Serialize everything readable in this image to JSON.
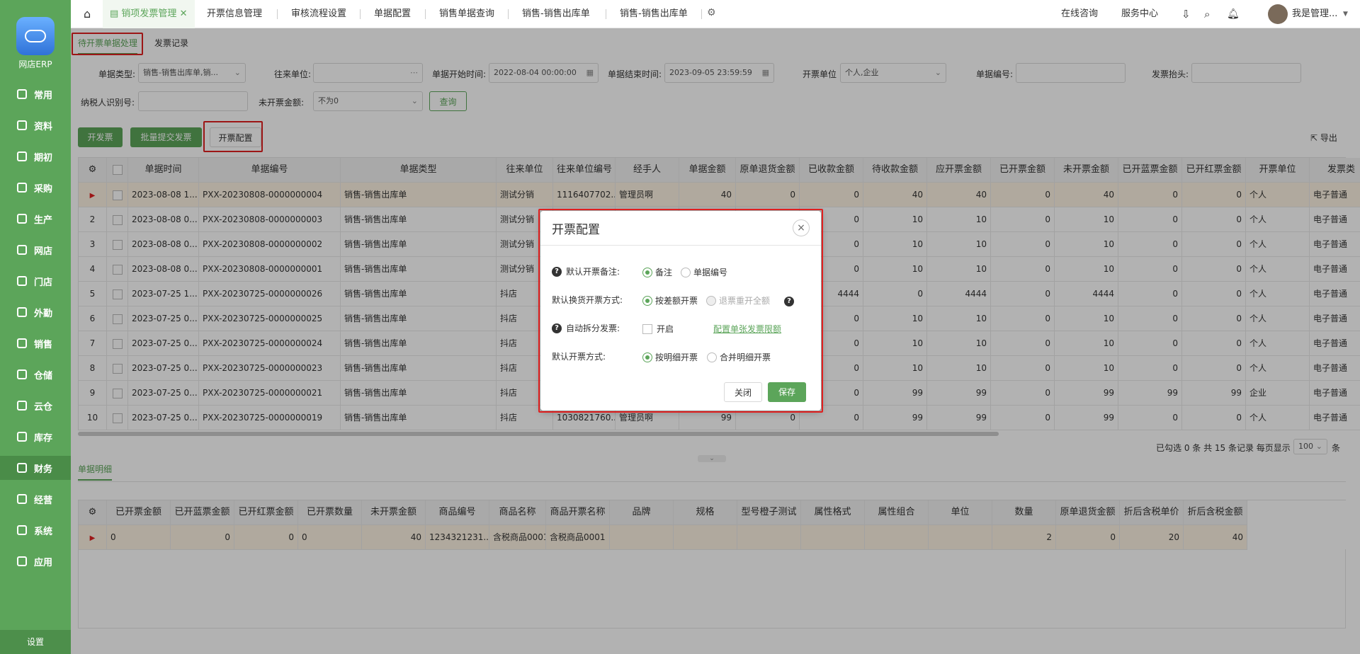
{
  "sidebar": {
    "logo_text": "网店ERP",
    "items": [
      {
        "label": "常用",
        "icon": "star-icon"
      },
      {
        "label": "资料",
        "icon": "document-icon"
      },
      {
        "label": "期初",
        "icon": "clock-icon"
      },
      {
        "label": "采购",
        "icon": "cart-icon"
      },
      {
        "label": "生产",
        "icon": "factory-icon"
      },
      {
        "label": "网店",
        "icon": "shop-icon"
      },
      {
        "label": "门店",
        "icon": "store-icon"
      },
      {
        "label": "外勤",
        "icon": "location-icon"
      },
      {
        "label": "销售",
        "icon": "chart-icon"
      },
      {
        "label": "仓储",
        "icon": "warehouse-icon"
      },
      {
        "label": "云仓",
        "icon": "cloud-icon"
      },
      {
        "label": "库存",
        "icon": "inventory-icon"
      },
      {
        "label": "财务",
        "icon": "finance-icon"
      },
      {
        "label": "经营",
        "icon": "business-icon"
      },
      {
        "label": "系统",
        "icon": "gear-icon"
      },
      {
        "label": "应用",
        "icon": "plus-icon"
      }
    ],
    "settings_label": "设置"
  },
  "topbar": {
    "tabs": [
      "销项发票管理",
      "开票信息管理",
      "审核流程设置",
      "单据配置",
      "销售单据查询",
      "销售-销售出库单",
      "销售-销售出库单"
    ],
    "online_consult": "在线咨询",
    "service_center": "服务中心",
    "user_name": "我是管理..."
  },
  "subtabs": [
    "待开票单据处理",
    "发票记录"
  ],
  "filters": {
    "doc_type_label": "单据类型:",
    "doc_type_value": "销售-销售出库单,销...",
    "partner_label": "往来单位:",
    "start_label": "单据开始时间:",
    "start_value": "2022-08-04 00:00:00",
    "end_label": "单据结束时间:",
    "end_value": "2023-09-05 23:59:59",
    "unit_label": "开票单位",
    "unit_value": "个人,企业",
    "doc_no_label": "单据编号:",
    "header_label": "发票抬头:",
    "tax_id_label": "纳税人识别号:",
    "amount_label": "未开票金额:",
    "amount_value": "不为0",
    "query_button": "查询"
  },
  "toolbar": {
    "issue_button": "开发票",
    "batch_button": "批量提交发票",
    "config_button": "开票配置",
    "export_button": "导出"
  },
  "table": {
    "headers": [
      "单据时间",
      "单据编号",
      "单据类型",
      "往来单位",
      "往来单位编号",
      "经手人",
      "单据金额",
      "原单退货金额",
      "已收款金额",
      "待收款金额",
      "应开票金额",
      "已开票金额",
      "未开票金额",
      "已开蓝票金额",
      "已开红票金额",
      "开票单位",
      "发票类"
    ],
    "rows": [
      [
        "1",
        "2023-08-08 1...",
        "PXX-20230808-0000000004",
        "销售-销售出库单",
        "测试分销",
        "1116407702...",
        "管理员啊",
        "40",
        "0",
        "0",
        "40",
        "40",
        "0",
        "40",
        "0",
        "0",
        "个人",
        "电子普通"
      ],
      [
        "2",
        "2023-08-08 0...",
        "PXX-20230808-0000000003",
        "销售-销售出库单",
        "测试分销",
        "",
        "",
        "",
        "",
        "0",
        "10",
        "10",
        "0",
        "10",
        "0",
        "0",
        "个人",
        "电子普通"
      ],
      [
        "3",
        "2023-08-08 0...",
        "PXX-20230808-0000000002",
        "销售-销售出库单",
        "测试分销",
        "",
        "",
        "",
        "",
        "0",
        "10",
        "10",
        "0",
        "10",
        "0",
        "0",
        "个人",
        "电子普通"
      ],
      [
        "4",
        "2023-08-08 0...",
        "PXX-20230808-0000000001",
        "销售-销售出库单",
        "测试分销",
        "",
        "",
        "",
        "",
        "0",
        "10",
        "10",
        "0",
        "10",
        "0",
        "0",
        "个人",
        "电子普通"
      ],
      [
        "5",
        "2023-07-25 1...",
        "PXX-20230725-0000000026",
        "销售-销售出库单",
        "抖店",
        "",
        "",
        "",
        "",
        "4444",
        "0",
        "4444",
        "0",
        "4444",
        "0",
        "0",
        "个人",
        "电子普通"
      ],
      [
        "6",
        "2023-07-25 0...",
        "PXX-20230725-0000000025",
        "销售-销售出库单",
        "抖店",
        "",
        "",
        "",
        "",
        "0",
        "10",
        "10",
        "0",
        "10",
        "0",
        "0",
        "个人",
        "电子普通"
      ],
      [
        "7",
        "2023-07-25 0...",
        "PXX-20230725-0000000024",
        "销售-销售出库单",
        "抖店",
        "",
        "",
        "",
        "",
        "0",
        "10",
        "10",
        "0",
        "10",
        "0",
        "0",
        "个人",
        "电子普通"
      ],
      [
        "8",
        "2023-07-25 0...",
        "PXX-20230725-0000000023",
        "销售-销售出库单",
        "抖店",
        "",
        "",
        "",
        "",
        "0",
        "10",
        "10",
        "0",
        "10",
        "0",
        "0",
        "个人",
        "电子普通"
      ],
      [
        "9",
        "2023-07-25 0...",
        "PXX-20230725-0000000021",
        "销售-销售出库单",
        "抖店",
        "",
        "",
        "",
        "",
        "0",
        "99",
        "99",
        "0",
        "99",
        "99",
        "99",
        "企业",
        "电子普通"
      ],
      [
        "10",
        "2023-07-25 0...",
        "PXX-20230725-0000000019",
        "销售-销售出库单",
        "抖店",
        "1030821760...",
        "管理员啊",
        "99",
        "0",
        "0",
        "99",
        "99",
        "0",
        "99",
        "0",
        "0",
        "个人",
        "电子普通"
      ]
    ]
  },
  "pager": {
    "summary": "已勾选 0 条 共 15 条记录 每页显示",
    "page_size": "100",
    "unit": "条"
  },
  "detail": {
    "tab_label": "单据明细",
    "headers": [
      "已开票金额",
      "已开蓝票金额",
      "已开红票金额",
      "已开票数量",
      "未开票金额",
      "商品编号",
      "商品名称",
      "商品开票名称",
      "品牌",
      "规格",
      "型号橙子测试",
      "属性格式",
      "属性组合",
      "单位",
      "数量",
      "原单退货金额",
      "折后含税单价",
      "折后含税金额"
    ],
    "row": [
      "0",
      "0",
      "0",
      "0",
      "40",
      "1234321231...",
      "含税商品0001",
      "含税商品0001",
      "",
      "",
      "",
      "",
      "",
      "",
      "2",
      "0",
      "20",
      "40"
    ]
  },
  "dialog": {
    "title": "开票配置",
    "remark_label": "默认开票备注:",
    "remark_opt1": "备注",
    "remark_opt2": "单据编号",
    "exchange_label": "默认换货开票方式:",
    "exchange_opt1": "按差额开票",
    "exchange_opt2": "退票重开全额",
    "split_label": "自动拆分发票:",
    "split_opt": "开启",
    "split_link": "配置单张发票限额",
    "method_label": "默认开票方式:",
    "method_opt1": "按明细开票",
    "method_opt2": "合并明细开票",
    "close_button": "关闭",
    "save_button": "保存"
  }
}
